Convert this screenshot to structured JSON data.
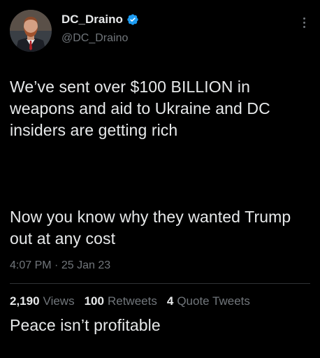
{
  "author": {
    "display_name": "DC_Draino",
    "handle": "@DC_Draino",
    "verified": true
  },
  "tweet": {
    "paragraphs": [
      "We’ve sent over $100 BILLION in weapons and aid to Ukraine and DC insiders are getting rich",
      "Now you know why they wanted Trump out at any cost",
      "Peace isn’t profitable"
    ],
    "time": "4:07 PM",
    "separator": "·",
    "date": "25 Jan 23"
  },
  "stats": {
    "views_count": "2,190",
    "views_label": "Views",
    "retweets_count": "100",
    "retweets_label": "Retweets",
    "quotes_count": "4",
    "quotes_label": "Quote Tweets"
  },
  "colors": {
    "background": "#000000",
    "primary_text": "#e7e9ea",
    "secondary_text": "#71767b",
    "verified_blue": "#1d9bf0",
    "divider": "#2f3336"
  },
  "icons": {
    "verified": "verified-badge-icon",
    "more": "more-options-icon"
  }
}
